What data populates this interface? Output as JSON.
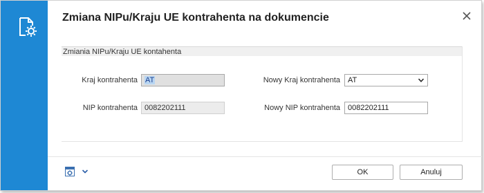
{
  "window": {
    "title": "Zmiana NIPu/Kraju UE kontrahenta na dokumencie"
  },
  "section": {
    "header": "Zmiania NIPu/Kraju UE kontahenta"
  },
  "form": {
    "kraj_label": "Kraj kontrahenta",
    "kraj_value": "AT",
    "nip_label": "NIP kontrahenta",
    "nip_value": "0082202111",
    "nowy_kraj_label": "Nowy Kraj kontrahenta",
    "nowy_kraj_value": "AT",
    "nowy_nip_label": "Nowy NIP kontrahenta",
    "nowy_nip_value": "0082202111"
  },
  "footer": {
    "ok_label": "OK",
    "cancel_label": "Anuluj"
  },
  "icons": {
    "sidebar": "document-gear-icon",
    "close": "close-icon",
    "calculator": "calculator-icon",
    "chevron": "chevron-down-icon"
  },
  "colors": {
    "accent": "#1e88d4"
  }
}
